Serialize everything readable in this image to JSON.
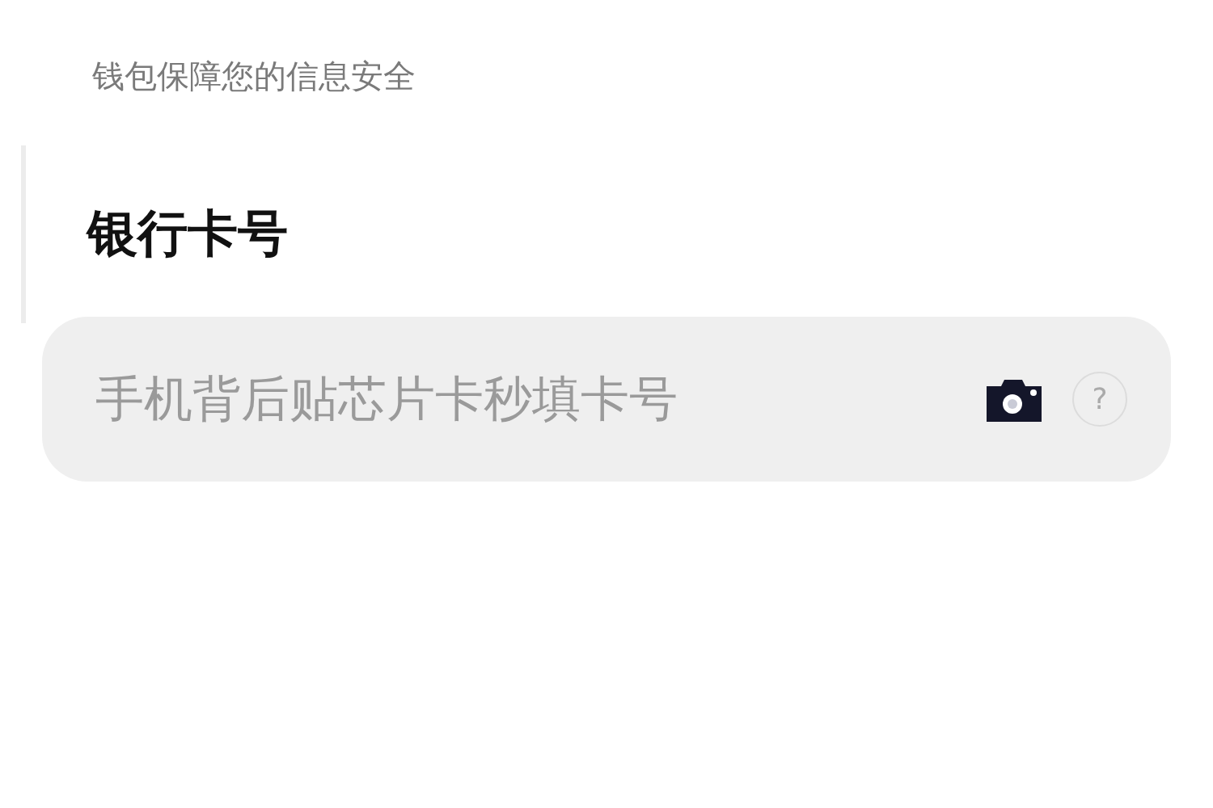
{
  "notice": "钱包保障您的信息安全",
  "section": {
    "title": "银行卡号"
  },
  "card_field": {
    "placeholder": "手机背后贴芯片卡秒填卡号",
    "help": "?"
  }
}
